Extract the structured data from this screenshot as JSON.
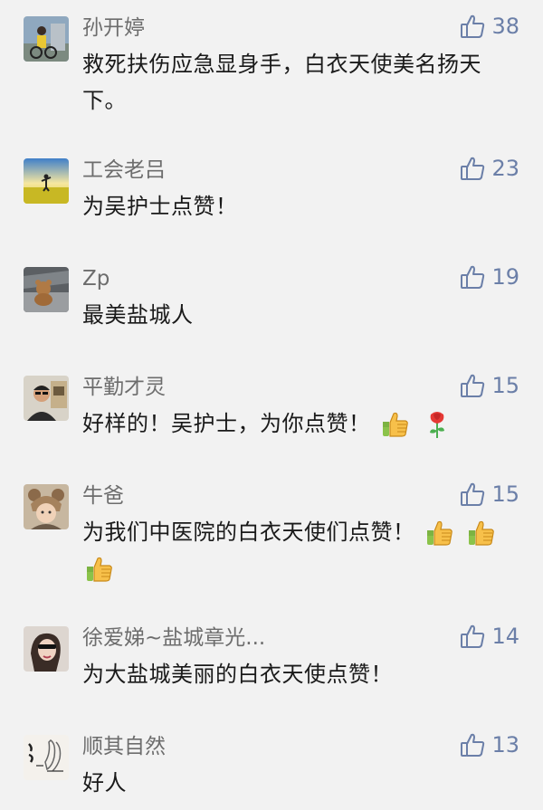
{
  "comments": [
    {
      "name": "孙开婷",
      "text": "救死扶伤应急显身手，白衣天使美名扬天下。",
      "likes": "38",
      "avatar": "person-on-bike"
    },
    {
      "name": "工会老吕",
      "text": "为吴护士点赞！",
      "likes": "23",
      "avatar": "sunrise-field"
    },
    {
      "name": "Zp",
      "text": "最美盐城人",
      "likes": "19",
      "avatar": "teddy-bear-in-car"
    },
    {
      "name": "平勤才灵",
      "text": "好样的！吴护士，为你点赞！",
      "likes": "15",
      "avatar": "man-portrait",
      "emojis": [
        "thumbs-up",
        "rose"
      ]
    },
    {
      "name": "牛爸",
      "text": "为我们中医院的白衣天使们点赞！",
      "likes": "15",
      "avatar": "child-bear-hat",
      "emojis": [
        "thumbs-up",
        "thumbs-up",
        "thumbs-up"
      ]
    },
    {
      "name": "徐爱娣~盐城章光...",
      "text": "为大盐城美丽的白衣天使点赞！",
      "likes": "14",
      "avatar": "woman-sunglasses"
    },
    {
      "name": "顺其自然",
      "text": "好人",
      "likes": "13",
      "avatar": "calligraphy-hands"
    }
  ]
}
